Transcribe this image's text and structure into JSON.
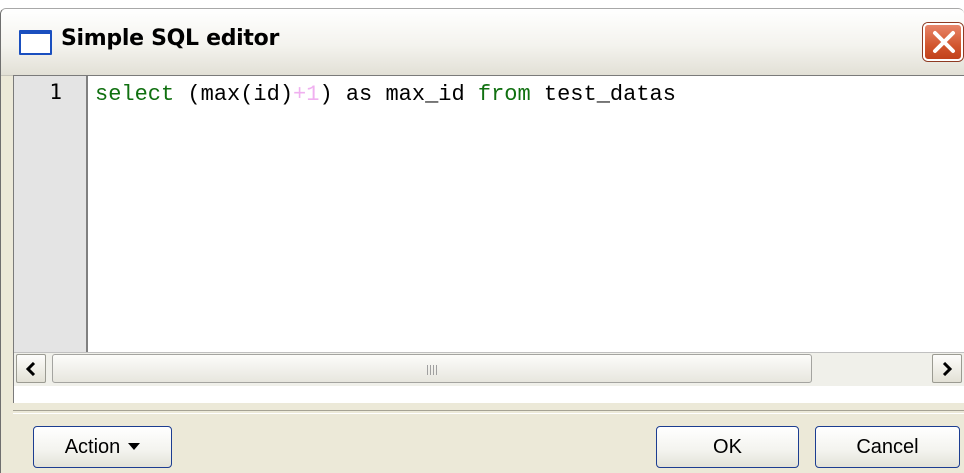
{
  "window": {
    "title": "Simple SQL editor"
  },
  "editor": {
    "line_number": "1",
    "tokens": {
      "select_kw": "select",
      "sp1": " ",
      "expr_open": "(max(id)",
      "plus_one": "+1",
      "expr_close": ")",
      "alias": " as max_id ",
      "from_kw": "from",
      "table": " test_datas"
    }
  },
  "buttons": {
    "action_label": "Action",
    "ok_label": "OK",
    "cancel_label": "Cancel"
  },
  "colors": {
    "keyword": "#107010",
    "operator": "#f0b0f0",
    "close_button": "#d2562e"
  }
}
